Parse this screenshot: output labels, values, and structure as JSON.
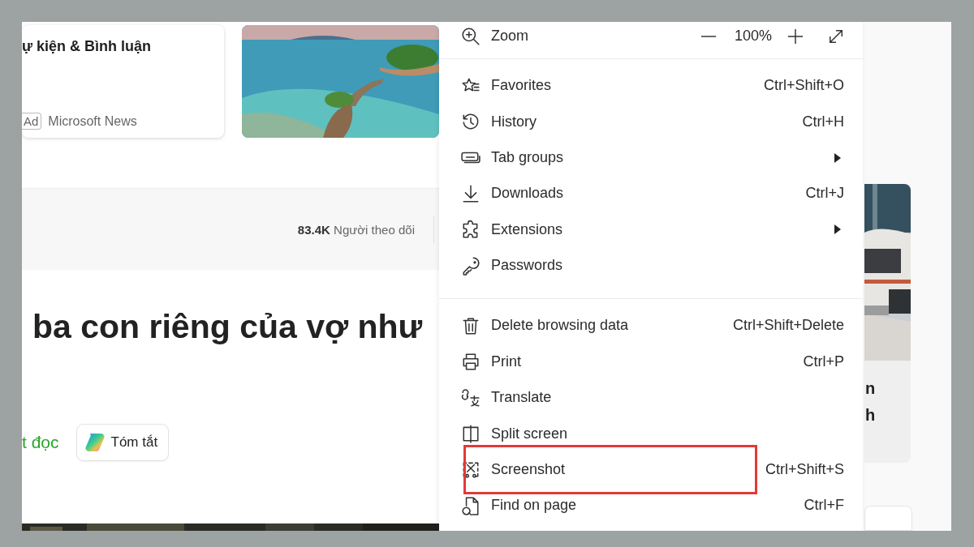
{
  "article_card": {
    "title": "ự kiện & Bình luận",
    "badge": "Ad",
    "source": "Microsoft News"
  },
  "publisher_bar": {
    "followers": "**83.4K** Người theo dõi"
  },
  "headline": "ba con riêng của vợ như",
  "actions": {
    "listen_link": "t đọc",
    "summary_button": "Tóm tắt"
  },
  "side_card": {
    "lines": [
      "n",
      "h"
    ]
  },
  "menu": {
    "zoom": {
      "label": "Zoom",
      "value": "100%"
    },
    "sections": [
      {
        "items": [
          {
            "label": "Favorites",
            "kind": "shortcut",
            "shortcut": "Ctrl+Shift+O",
            "annotated": false
          },
          {
            "label": "History",
            "kind": "shortcut",
            "shortcut": "Ctrl+H",
            "annotated": false
          },
          {
            "label": "Tab groups",
            "kind": "submenu",
            "annotated": false
          },
          {
            "label": "Downloads",
            "kind": "shortcut",
            "shortcut": "Ctrl+J",
            "annotated": false
          },
          {
            "label": "Extensions",
            "kind": "submenu",
            "annotated": false
          },
          {
            "label": "Passwords",
            "kind": "plain",
            "annotated": false
          }
        ]
      },
      {
        "items": [
          {
            "label": "Delete browsing data",
            "kind": "shortcut",
            "shortcut": "Ctrl+Shift+Delete",
            "annotated": false
          },
          {
            "label": "Print",
            "kind": "shortcut",
            "shortcut": "Ctrl+P",
            "annotated": false
          },
          {
            "label": "Translate",
            "kind": "plain",
            "annotated": false
          },
          {
            "label": "Split screen",
            "kind": "plain",
            "annotated": false
          },
          {
            "label": "Screenshot",
            "kind": "shortcut",
            "shortcut": "Ctrl+Shift+S",
            "annotated": true
          },
          {
            "label": "Find on page",
            "kind": "shortcut",
            "shortcut": "Ctrl+F",
            "annotated": false
          }
        ]
      }
    ]
  }
}
